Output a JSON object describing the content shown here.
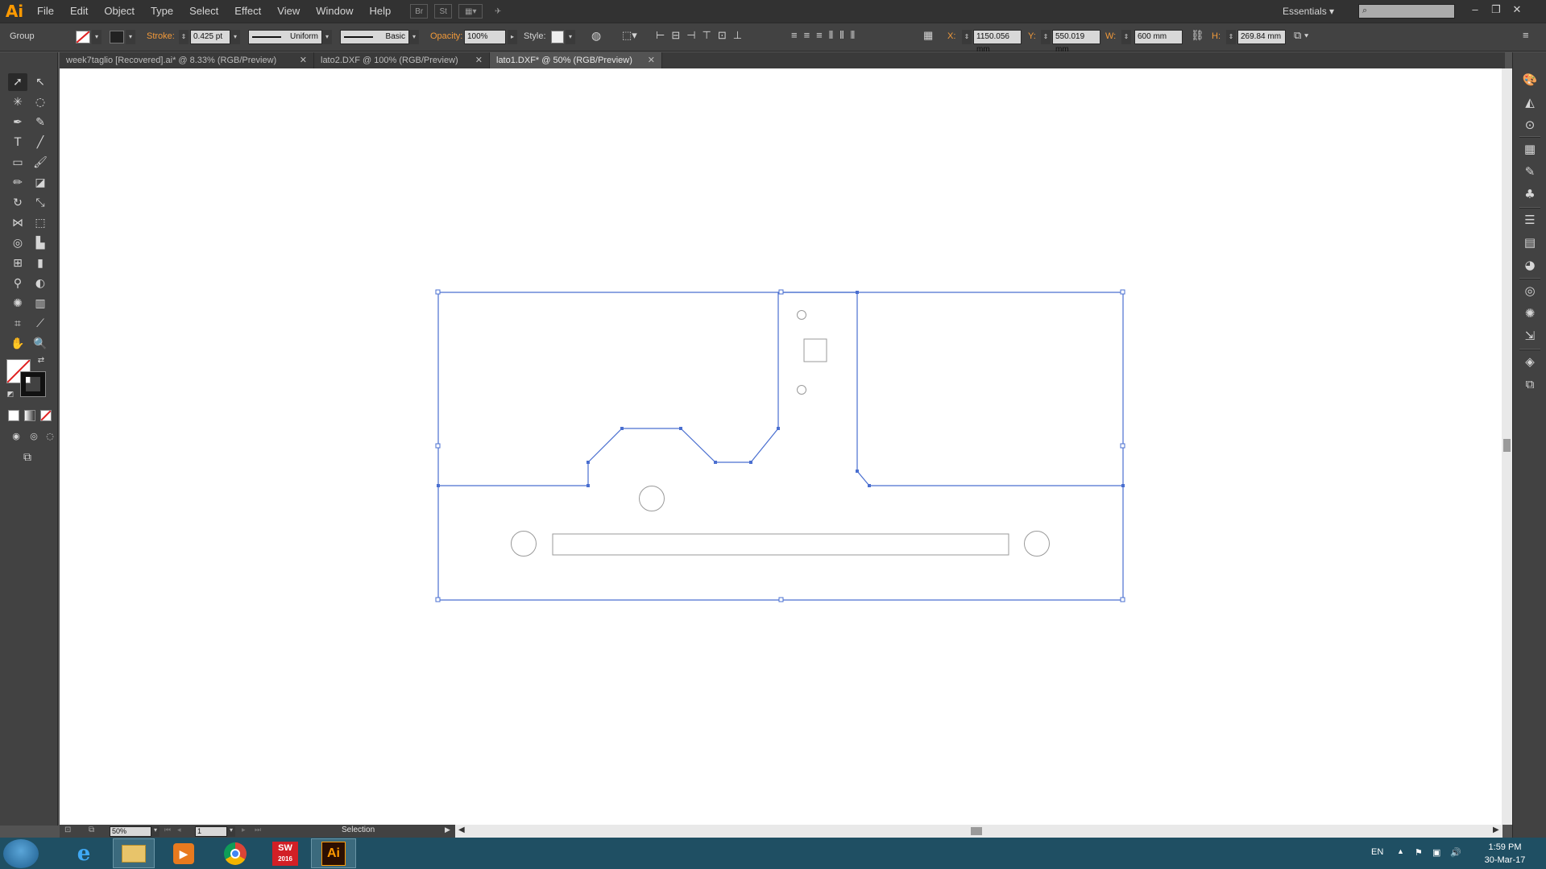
{
  "app": {
    "logo": "Ai"
  },
  "menu": [
    "File",
    "Edit",
    "Object",
    "Type",
    "Select",
    "Effect",
    "View",
    "Window",
    "Help"
  ],
  "menubar": {
    "bridge_label": "Br",
    "stock_label": "St",
    "workspace": "Essentials",
    "search_placeholder": ""
  },
  "control": {
    "selection_type": "Group",
    "stroke_label": "Stroke:",
    "stroke_weight": "0.425 pt",
    "profile": "Uniform",
    "brush": "Basic",
    "opacity_label": "Opacity:",
    "opacity": "100%",
    "style_label": "Style:",
    "x_label": "X:",
    "x": "1150.056 mm",
    "y_label": "Y:",
    "y": "550.019 mm",
    "w_label": "W:",
    "w": "600 mm",
    "h_label": "H:",
    "h": "269.84 mm"
  },
  "tabs": [
    {
      "label": "week7taglio [Recovered].ai* @ 8.33% (RGB/Preview)",
      "active": false
    },
    {
      "label": "lato2.DXF @ 100% (RGB/Preview)",
      "active": false
    },
    {
      "label": "lato1.DXF* @ 50% (RGB/Preview)",
      "active": true
    }
  ],
  "status": {
    "zoom": "50%",
    "artboard": "1",
    "mode": "Selection"
  },
  "taskbar": {
    "language": "EN",
    "time": "1:59 PM",
    "date": "30-Mar-17",
    "sw_label": "SW",
    "sw_year": "2016",
    "ai_label": "Ai"
  },
  "colors": {
    "selection": "#4a6fd0",
    "accent": "#ff9a00",
    "canvas": "#ffffff",
    "ui_dark": "#424242"
  }
}
